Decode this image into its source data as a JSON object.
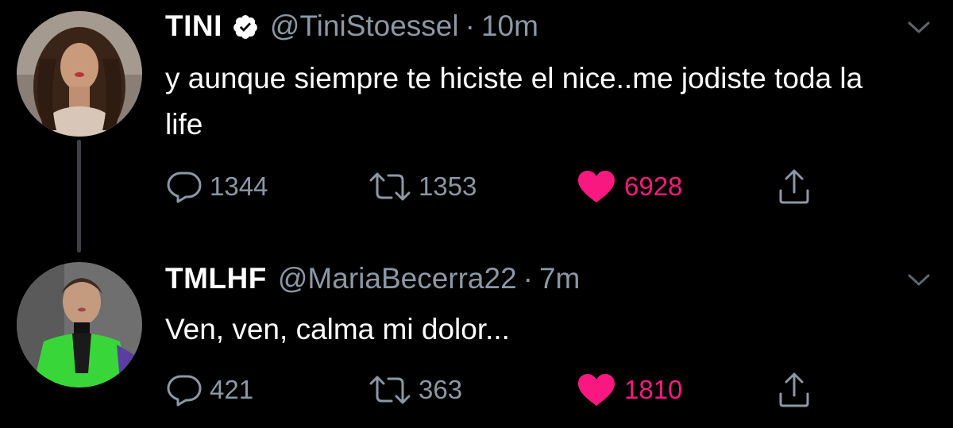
{
  "tweets": [
    {
      "display_name": "TINI",
      "verified": true,
      "handle": "@TiniStoessel",
      "separator": "·",
      "time": "10m",
      "text": "y aunque siempre te hiciste el nice..me jodiste toda la life",
      "replies": "1344",
      "retweets": "1353",
      "likes": "6928",
      "liked": true
    },
    {
      "display_name": "TMLHF",
      "verified": false,
      "handle": "@MariaBecerra22",
      "separator": "·",
      "time": "7m",
      "text": "Ven, ven, calma mi dolor...",
      "replies": "421",
      "retweets": "363",
      "likes": "1810",
      "liked": true
    }
  ],
  "colors": {
    "background": "#000000",
    "text": "#ffffff",
    "secondary": "#8b98a5",
    "like": "#f91880",
    "thread_line": "#3d4248"
  },
  "icons": {
    "verified": "verified-badge-icon",
    "menu": "chevron-down-icon",
    "reply": "reply-bubble-icon",
    "retweet": "retweet-arrows-icon",
    "like": "heart-icon",
    "share": "share-upload-icon"
  }
}
